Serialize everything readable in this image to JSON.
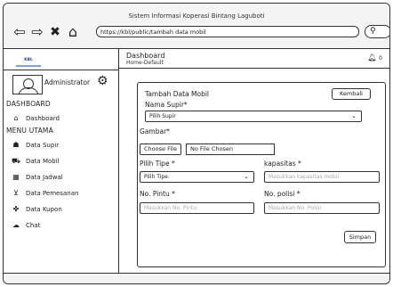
{
  "window": {
    "title": "Sistem Informasi Koperasi Bintang Laguboti"
  },
  "browser": {
    "url": "https://kbl/public/tambah data mobil",
    "nav": {
      "back_icon": "arrow-left-icon",
      "forward_icon": "arrow-right-icon",
      "close_icon": "close-icon",
      "home_icon": "home-icon"
    }
  },
  "sidebar": {
    "logo_text": "KBL",
    "user": "Administrator",
    "section_dashboard": "DASHBOARD",
    "section_menu": "MENU UTAMA",
    "items": [
      {
        "label": "Dashboard",
        "icon": "home-icon"
      },
      {
        "label": "Data Supir",
        "icon": "users-icon"
      },
      {
        "label": "Data Mobil",
        "icon": "car-icon"
      },
      {
        "label": "Data Jadwal",
        "icon": "calendar-icon"
      },
      {
        "label": "Data Pemesanan",
        "icon": "cart-icon"
      },
      {
        "label": "Data Kupon",
        "icon": "ticket-icon"
      },
      {
        "label": "Chat",
        "icon": "chat-icon"
      }
    ]
  },
  "header": {
    "title": "Dashboard",
    "breadcrumb": "Home-Default",
    "notification_count": "0"
  },
  "form": {
    "title": "Tambah Data Mobil",
    "back_button": "Kembali",
    "driver_label": "Nama Supir*",
    "driver_value": "Pilih Supir",
    "image_label": "Gambar*",
    "choose_file": "Choose File",
    "no_file": "No File Chosen",
    "type_label": "Pilih Tipe *",
    "type_value": "Pilih Tipe.",
    "capacity_label": "kapasitas *",
    "capacity_placeholder": "Masukkan kapasitas mobil",
    "doors_label": "No. Pintu *",
    "doors_placeholder": "Masukkan No. Pintu",
    "plate_label": "No. polisi *",
    "plate_placeholder": "Masukkan No. Polisi",
    "submit_button": "Simpan"
  }
}
